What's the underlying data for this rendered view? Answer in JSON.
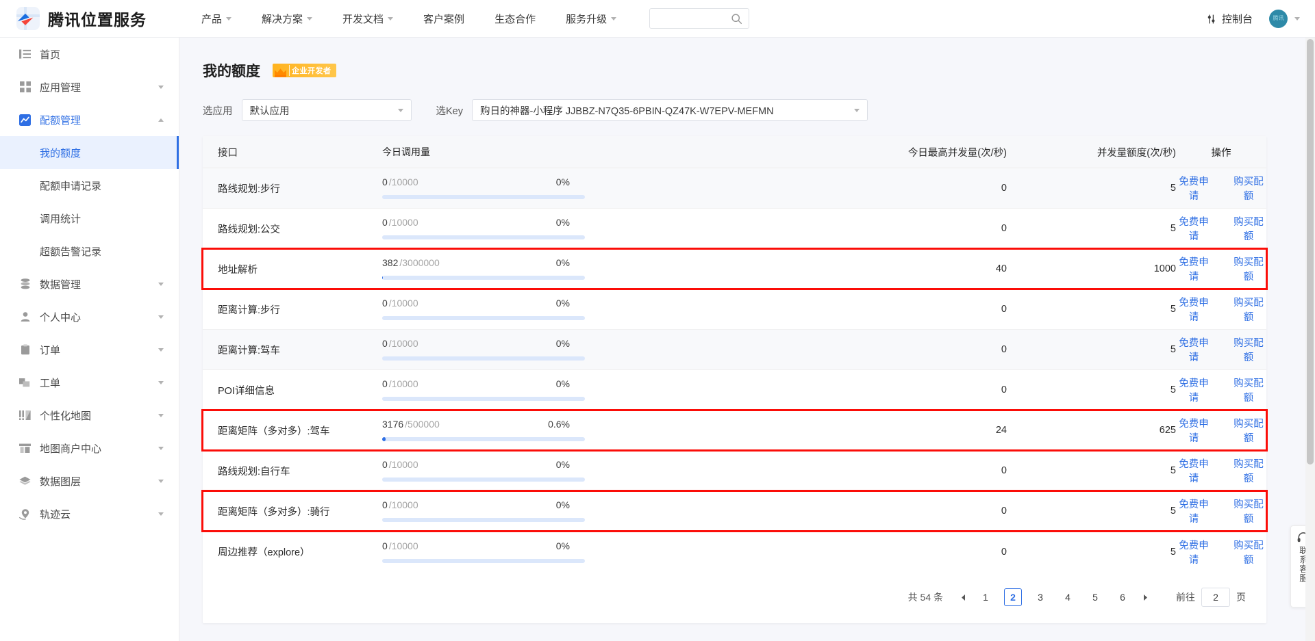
{
  "topbar": {
    "brand_name": "腾讯位置服务",
    "nav": [
      {
        "label": "产品",
        "has_caret": true
      },
      {
        "label": "解决方案",
        "has_caret": true
      },
      {
        "label": "开发文档",
        "has_caret": true
      },
      {
        "label": "客户案例",
        "has_caret": false
      },
      {
        "label": "生态合作",
        "has_caret": false
      },
      {
        "label": "服务升级",
        "has_caret": true
      }
    ],
    "search_placeholder": "",
    "search_value": "",
    "console_label": "控制台",
    "avatar_text": "腾讯"
  },
  "sidebar": {
    "items": [
      {
        "label": "首页",
        "icon": "list-icon",
        "expandable": false
      },
      {
        "label": "应用管理",
        "icon": "grid-icon",
        "expandable": true,
        "expanded": false
      },
      {
        "label": "配额管理",
        "icon": "chart-icon",
        "expandable": true,
        "expanded": true,
        "active": true
      },
      {
        "label": "数据管理",
        "icon": "database-icon",
        "expandable": true,
        "expanded": false
      },
      {
        "label": "个人中心",
        "icon": "user-icon",
        "expandable": true,
        "expanded": false
      },
      {
        "label": "订单",
        "icon": "clipboard-icon",
        "expandable": true,
        "expanded": false
      },
      {
        "label": "工单",
        "icon": "ticket-icon",
        "expandable": true,
        "expanded": false
      },
      {
        "label": "个性化地图",
        "icon": "map-style-icon",
        "expandable": true,
        "expanded": false
      },
      {
        "label": "地图商户中心",
        "icon": "store-icon",
        "expandable": true,
        "expanded": false
      },
      {
        "label": "数据图层",
        "icon": "layers-icon",
        "expandable": true,
        "expanded": false
      },
      {
        "label": "轨迹云",
        "icon": "track-icon",
        "expandable": true,
        "expanded": false
      }
    ],
    "sub_items": [
      {
        "label": "我的额度",
        "active": true
      },
      {
        "label": "配额申请记录",
        "active": false
      },
      {
        "label": "调用统计",
        "active": false
      },
      {
        "label": "超额告警记录",
        "active": false
      }
    ]
  },
  "page": {
    "title": "我的额度",
    "badge": "企业开发者"
  },
  "filters": {
    "app_label": "选应用",
    "app_value": "默认应用",
    "key_label": "选Key",
    "key_value": "购日的神器-小程序 JJBBZ-N7Q35-6PBIN-QZ47K-W7EPV-MEFMN"
  },
  "table": {
    "headers": {
      "name": "接口",
      "usage": "今日调用量",
      "concurrency": "今日最高并发量(次/秒)",
      "quota": "并发量额度(次/秒)",
      "action": "操作"
    },
    "actions": {
      "free_apply": "免费申请",
      "buy_quota": "购买配额"
    },
    "rows": [
      {
        "name": "路线规划:步行",
        "used": "0",
        "total": "/10000",
        "pct": "0%",
        "fill": 0,
        "concurrency": "0",
        "quota": "5",
        "highlighted": false
      },
      {
        "name": "路线规划:公交",
        "used": "0",
        "total": "/10000",
        "pct": "0%",
        "fill": 0,
        "concurrency": "0",
        "quota": "5",
        "highlighted": false
      },
      {
        "name": "地址解析",
        "used": "382",
        "total": "/3000000",
        "pct": "0%",
        "fill": 0.1,
        "concurrency": "40",
        "quota": "1000",
        "highlighted": true
      },
      {
        "name": "距离计算:步行",
        "used": "0",
        "total": "/10000",
        "pct": "0%",
        "fill": 0,
        "concurrency": "0",
        "quota": "5",
        "highlighted": false
      },
      {
        "name": "距离计算:驾车",
        "used": "0",
        "total": "/10000",
        "pct": "0%",
        "fill": 0,
        "concurrency": "0",
        "quota": "5",
        "highlighted": false
      },
      {
        "name": "POI详细信息",
        "used": "0",
        "total": "/10000",
        "pct": "0%",
        "fill": 0,
        "concurrency": "0",
        "quota": "5",
        "highlighted": false
      },
      {
        "name": "距离矩阵（多对多）:驾车",
        "used": "3176",
        "total": "/500000",
        "pct": "0.6%",
        "fill": 1.8,
        "concurrency": "24",
        "quota": "625",
        "highlighted": true
      },
      {
        "name": "路线规划:自行车",
        "used": "0",
        "total": "/10000",
        "pct": "0%",
        "fill": 0,
        "concurrency": "0",
        "quota": "5",
        "highlighted": false
      },
      {
        "name": "距离矩阵（多对多）:骑行",
        "used": "0",
        "total": "/10000",
        "pct": "0%",
        "fill": 0,
        "concurrency": "0",
        "quota": "5",
        "highlighted": true
      },
      {
        "name": "周边推荐（explore）",
        "used": "0",
        "total": "/10000",
        "pct": "0%",
        "fill": 0,
        "concurrency": "0",
        "quota": "5",
        "highlighted": false
      }
    ]
  },
  "pagination": {
    "total_text": "共 54 条",
    "pages": [
      "1",
      "2",
      "3",
      "4",
      "5",
      "6"
    ],
    "current": "2",
    "jump_label": "前往",
    "jump_value": "2",
    "page_unit": "页"
  },
  "service": {
    "label": "联系客服"
  },
  "colors": {
    "accent": "#2f6fe4",
    "highlight": "#fb0d08",
    "badge": "#ffb31f",
    "bar_track": "#dbe7fb"
  }
}
